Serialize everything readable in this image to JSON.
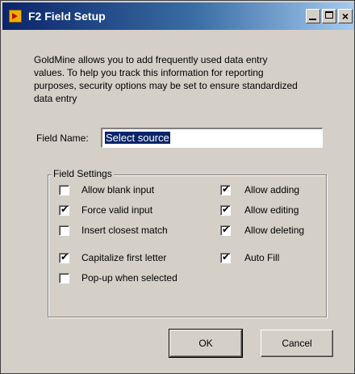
{
  "window": {
    "title": "F2 Field Setup",
    "controls": {
      "minimize": "minimize",
      "maximize": "maximize",
      "close": "×"
    }
  },
  "description": "GoldMine allows you to add frequently used data entry values. To help you track this information for reporting purposes, security options may be set to ensure standardized data entry",
  "field_name": {
    "label": "Field Name:",
    "value": "Select source"
  },
  "field_settings": {
    "title": "Field Settings",
    "options": [
      {
        "label": "Allow blank input",
        "checked": false
      },
      {
        "label": "Force valid input",
        "checked": true
      },
      {
        "label": "Insert closest match",
        "checked": false
      },
      {
        "label": "Capitalize first letter",
        "checked": true
      },
      {
        "label": "Pop-up when selected",
        "checked": false
      },
      {
        "label": "Allow adding",
        "checked": true
      },
      {
        "label": "Allow editing",
        "checked": true
      },
      {
        "label": "Allow deleting",
        "checked": true
      },
      {
        "label": "Auto Fill",
        "checked": true
      }
    ]
  },
  "buttons": {
    "ok": "OK",
    "cancel": "Cancel"
  }
}
